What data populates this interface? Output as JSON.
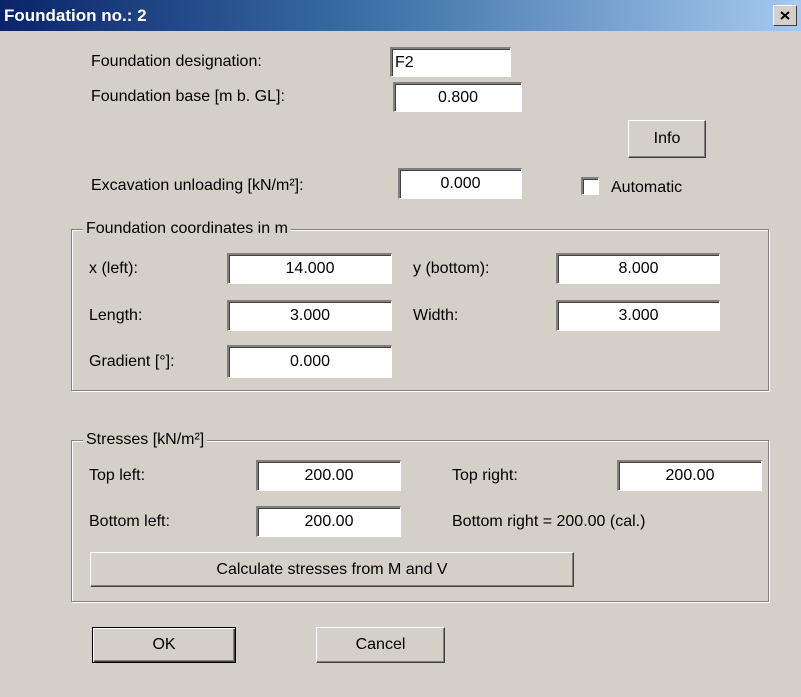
{
  "window": {
    "title": "Foundation no.: 2"
  },
  "icons": {
    "close": "close-icon"
  },
  "general": {
    "designation_label": "Foundation designation:",
    "designation_value": "F2",
    "base_label": "Foundation base [m b. GL]:",
    "base_value": "0.800",
    "excavation_label": "Excavation unloading [kN/m²]:",
    "excavation_value": "0.000",
    "info_label": "Info",
    "automatic_label": "Automatic",
    "automatic_checked": false
  },
  "coordinates": {
    "title": "Foundation coordinates in m",
    "x_label": "x (left):",
    "x_value": "14.000",
    "y_label": "y (bottom):",
    "y_value": "8.000",
    "length_label": "Length:",
    "length_value": "3.000",
    "width_label": "Width:",
    "width_value": "3.000",
    "gradient_label": "Gradient [°]:",
    "gradient_value": "0.000"
  },
  "stresses": {
    "title": "Stresses [kN/m²]",
    "top_left_label": "Top left:",
    "top_left_value": "200.00",
    "top_right_label": "Top right:",
    "top_right_value": "200.00",
    "bottom_left_label": "Bottom left:",
    "bottom_left_value": "200.00",
    "bottom_right_text": "Bottom right = 200.00 (cal.)",
    "calc_button": "Calculate stresses from M and V"
  },
  "buttons": {
    "ok": "OK",
    "cancel": "Cancel"
  }
}
